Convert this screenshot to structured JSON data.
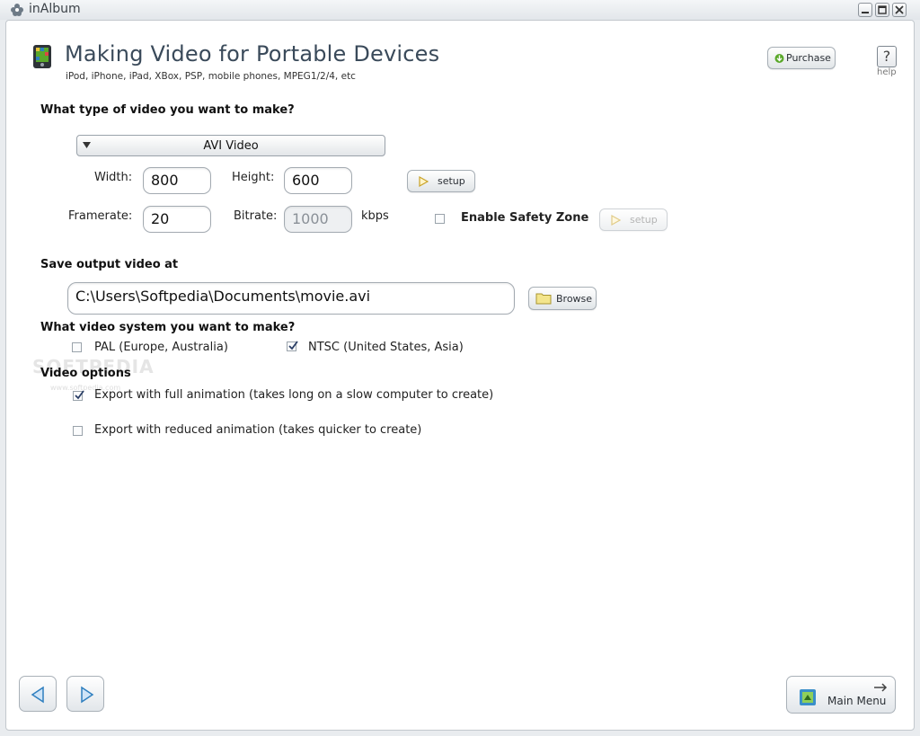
{
  "window": {
    "title": "inAlbum"
  },
  "header": {
    "title": "Making Video for Portable Devices",
    "subtitle": "iPod, iPhone, iPad, XBox, PSP, mobile phones, MPEG1/2/4, etc",
    "purchase_label": "Purchase",
    "help_glyph": "?",
    "help_label": "help"
  },
  "video_type": {
    "question": "What type of video you want to make?",
    "selected": "AVI Video",
    "width_label": "Width:",
    "width_value": "800",
    "height_label": "Height:",
    "height_value": "600",
    "setup_label": "setup",
    "framerate_label": "Framerate:",
    "framerate_value": "20",
    "bitrate_label": "Bitrate:",
    "bitrate_value": "1000",
    "bitrate_unit": "kbps",
    "safety_zone_label": "Enable Safety Zone",
    "safety_zone_checked": false,
    "safety_setup_label": "setup"
  },
  "output": {
    "question": "Save output video at",
    "path": "C:\\Users\\Softpedia\\Documents\\movie.avi",
    "browse_label": "Browse"
  },
  "video_system": {
    "question": "What video system you want to make?",
    "pal_label": "PAL (Europe, Australia)",
    "pal_checked": false,
    "ntsc_label": "NTSC (United States, Asia)",
    "ntsc_checked": true
  },
  "video_options": {
    "heading": "Video options",
    "full_label": "Export with full animation (takes long on a slow computer to create)",
    "full_checked": true,
    "reduced_label": "Export with reduced animation (takes quicker to create)",
    "reduced_checked": false
  },
  "watermark": {
    "brand": "SOFTPEDIA",
    "url": "www.softpedia.com"
  },
  "footer": {
    "main_menu_label": "Main Menu"
  },
  "colors": {
    "accent": "#3a4a5a",
    "icon_green": "#5aa82a",
    "icon_blue": "#2f7fbf"
  },
  "icons": [
    "flower-logo-icon",
    "minimize-icon",
    "maximize-icon",
    "close-icon",
    "device-icon",
    "download-arrow-icon",
    "dropdown-arrow-icon",
    "play-icon",
    "folder-icon",
    "check-icon",
    "back-arrow-icon",
    "forward-arrow-icon",
    "main-menu-icon"
  ]
}
